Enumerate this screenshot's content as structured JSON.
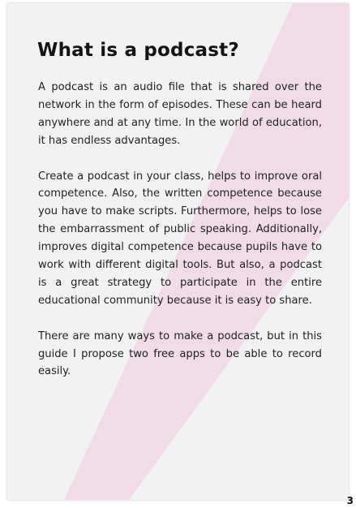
{
  "document": {
    "title": "What is a podcast?",
    "paragraphs": [
      "A podcast is an audio file that is shared over the network in the form of episodes. These can be heard anywhere and at any time. In the world of education, it has endless advantages.",
      "Create a podcast in your class, helps to improve oral competence. Also, the written competence because you have to make scripts. Furthermore, helps to lose the embarrassment of public speaking. Additionally, improves digital competence because pupils have to work with different digital tools. But also, a podcast is a great strategy to participate in the entire educational community because it is easy to share.",
      "There are many ways to make a podcast, but in this guide I propose two free apps to be able to record easily."
    ],
    "page_number": "3"
  },
  "colors": {
    "card_background": "#f3f2f2",
    "accent_stripe": "#efd7e4",
    "title_text": "#141414",
    "body_text": "#222222"
  }
}
